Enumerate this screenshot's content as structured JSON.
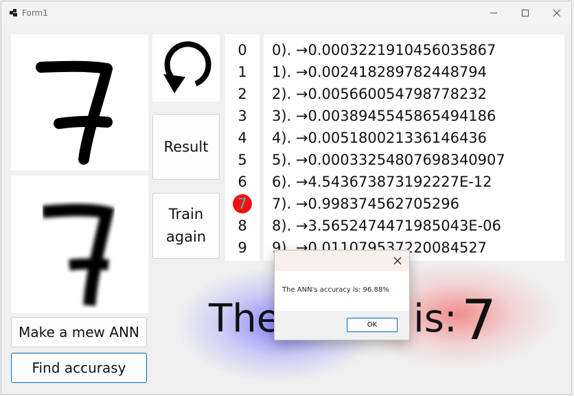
{
  "window": {
    "title": "Form1"
  },
  "buttons": {
    "result": "Result",
    "train_again": "Train\nagain",
    "make_new_ann": "Make a mew ANN",
    "find_accuracy": "Find accurasy"
  },
  "digits": [
    "0",
    "1",
    "2",
    "3",
    "4",
    "5",
    "6",
    "7",
    "8",
    "9"
  ],
  "highlighted_digit": "7",
  "outputs": [
    "0). →0.0003221910456035867",
    "1). →0.002418289782448794",
    "2). →0.005660054798778232",
    "3). →0.003894554586549418​6",
    "4). →0.005180021336146436",
    "5). →0.0003325480769834090​7",
    "6). →4.543673873192227E-12",
    "7). →0.998374562705296",
    "8). →3.5652474471985043E-06",
    "9). →0.011079537220084527"
  ],
  "result": {
    "text": "The result is:",
    "digit": "7"
  },
  "dialog": {
    "message": "The ANN's accuracy is: 96.88%",
    "ok_label": "OK"
  },
  "colors": {
    "highlight": "#ee1111",
    "accent": "#0067c0"
  }
}
